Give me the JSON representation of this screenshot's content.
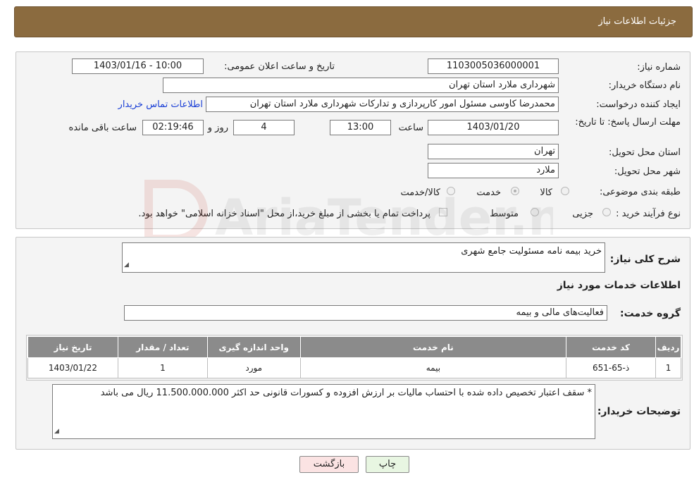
{
  "header": {
    "title": "جزئیات اطلاعات نیاز"
  },
  "need_info": {
    "need_number_label": "شماره نیاز:",
    "need_number": "1103005036000001",
    "announce_label": "تاریخ و ساعت اعلان عمومی:",
    "announce_value": "1403/01/16 - 10:00",
    "buyer_org_label": "نام دستگاه خریدار:",
    "buyer_org": "شهرداری ملارد استان تهران",
    "creator_label": "ایجاد کننده درخواست:",
    "creator": "محمدرضا کاوسی مسئول امور کارپردازی و تدارکات  شهرداری ملارد استان تهران",
    "contact_link": "اطلاعات تماس خریدار",
    "deadline_label": "مهلت ارسال پاسخ: تا تاریخ:",
    "deadline_date": "1403/01/20",
    "time_label": "ساعت",
    "deadline_time": "13:00",
    "days_value": "4",
    "days_label": "روز و",
    "remaining_time": "02:19:46",
    "remaining_label": "ساعت باقی مانده",
    "province_label": "استان محل تحویل:",
    "province": "تهران",
    "city_label": "شهر محل تحویل:",
    "city": "ملارد",
    "category_label": "طبقه بندی موضوعی:",
    "category_options": [
      "کالا",
      "خدمت",
      "کالا/خدمت"
    ],
    "category_selected": "خدمت",
    "purchase_type_label": "نوع فرآیند خرید :",
    "purchase_options": [
      "جزیی",
      "متوسط"
    ],
    "payment_note": "پرداخت تمام یا بخشی از مبلغ خرید،از محل \"اسناد خزانه اسلامی\" خواهد بود."
  },
  "details": {
    "summary_label": "شرح کلی نیاز:",
    "summary": "خرید بیمه نامه مسئولیت جامع شهری",
    "services_title": "اطلاعات خدمات مورد نیاز",
    "service_group_label": "گروه خدمت:",
    "service_group": "فعالیت‌های مالی و بیمه",
    "table": {
      "headers": [
        "ردیف",
        "کد خدمت",
        "نام خدمت",
        "واحد اندازه گیری",
        "تعداد / مقدار",
        "تاریخ نیاز"
      ],
      "rows": [
        [
          "1",
          "ذ-65-651",
          "بیمه",
          "مورد",
          "1",
          "1403/01/22"
        ]
      ]
    },
    "buyer_notes_label": "توضیحات خریدار:",
    "buyer_notes": "* سقف اعتبار تخصیص داده شده با احتساب مالیات بر ارزش افزوده و کسورات قانونی حد اکثر 11.500.000.000 ریال می باشد"
  },
  "buttons": {
    "print": "چاپ",
    "back": "بازگشت"
  },
  "watermark": {
    "text": "AriaTender.neT"
  },
  "colors": {
    "header": "#8b6b3f",
    "table_header": "#8b8b8b",
    "link": "#1a3fd6"
  }
}
